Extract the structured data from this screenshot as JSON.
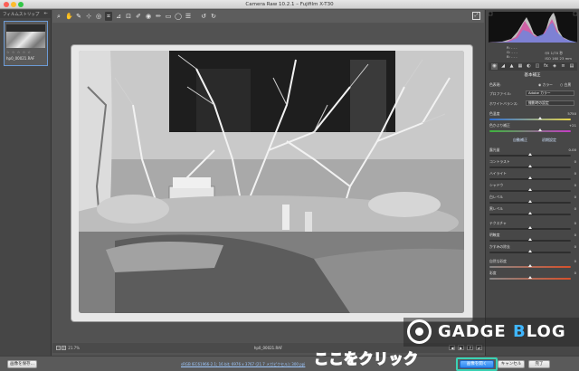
{
  "window": {
    "title": "Camera Raw 10.2.1  –  Fujifilm X-T30"
  },
  "toolbar": {
    "tools": [
      {
        "icon": "zoom-icon",
        "glyph": "⌕"
      },
      {
        "icon": "hand-icon",
        "glyph": "✋"
      },
      {
        "icon": "white-balance-icon",
        "glyph": "✎"
      },
      {
        "icon": "color-sampler-icon",
        "glyph": "⊹"
      },
      {
        "icon": "target-adjustment-icon",
        "glyph": "◎"
      },
      {
        "icon": "crop-icon",
        "glyph": "⌗"
      },
      {
        "icon": "straighten-icon",
        "glyph": "⊿"
      },
      {
        "icon": "transform-icon",
        "glyph": "⊡"
      },
      {
        "icon": "spot-removal-icon",
        "glyph": "✐"
      },
      {
        "icon": "red-eye-icon",
        "glyph": "◉"
      },
      {
        "icon": "adjustment-brush-icon",
        "glyph": "✏"
      },
      {
        "icon": "graduated-filter-icon",
        "glyph": "▭"
      },
      {
        "icon": "radial-filter-icon",
        "glyph": "◯"
      },
      {
        "icon": "preferences-icon",
        "glyph": "☰"
      },
      {
        "icon": "rotate-left-icon",
        "glyph": "↺"
      },
      {
        "icon": "rotate-right-icon",
        "glyph": "↻"
      }
    ],
    "active_tool": 5
  },
  "filmstrip": {
    "header": "フィルムストリップ",
    "collapse_glyph": "⇤",
    "thumb_stars": "☆ ☆ ☆ ☆ ☆",
    "thumb_filename": "hp0_00021.RAF"
  },
  "preview": {
    "zoom": "21.7%",
    "current_file": "hp0_00021.RAF",
    "nav_prev": "◀",
    "nav_next": "▶"
  },
  "footer": {
    "save_button": "画像を保存...",
    "workflow_link": "sRGB IEC61966-2.1; 16 bit; 6976 x 3767 (21.7 メガピクセル); 300 ppi",
    "open_button": "画像を開く",
    "cancel_button": "キャンセル",
    "done_button": "完了",
    "callout": "ここをクリック",
    "highlight_color": "#39d2b4"
  },
  "watermark": {
    "prefix": "GADGE ",
    "highlight": "B",
    "suffix": "LOG"
  },
  "histogram": {
    "r_label": "R:",
    "g_label": "G:",
    "b_label": "B:",
    "r_value": "- - -",
    "g_value": "- - -",
    "b_value": "- - -",
    "exposure_line1": "f/5   1/70 秒",
    "exposure_line2": "ISO 160   23 mm"
  },
  "panel": {
    "title": "基本補正",
    "treatment_label": "色表現:",
    "treatment_color": "カラー",
    "treatment_bw": "白黒",
    "profile_label": "プロファイル:",
    "profile_value": "Adobe カラー",
    "wb_label": "ホワイトバランス:",
    "wb_value": "撮影時の設定",
    "temperature_label": "色温度",
    "temperature_value": "5750",
    "temperature_level": 0.62,
    "tint_label": "色かぶり補正",
    "tint_value": "+21",
    "tint_level": 0.62,
    "auto_label": "自動補正",
    "auto_default": "初期設定",
    "exposure_label": "露光量",
    "exposure_value": "0.00",
    "contrast_label": "コントラスト",
    "contrast_value": "0",
    "highlights_label": "ハイライト",
    "highlights_value": "0",
    "shadows_label": "シャドウ",
    "shadows_value": "0",
    "whites_label": "白レベル",
    "whites_value": "0",
    "blacks_label": "黒レベル",
    "blacks_value": "0",
    "texture_label": "テクスチャ",
    "texture_value": "0",
    "clarity_label": "明瞭度",
    "clarity_value": "0",
    "dehaze_label": "かすみの除去",
    "dehaze_value": "0",
    "vibrance_label": "自然な彩度",
    "vibrance_value": "0",
    "saturation_label": "彩度",
    "saturation_value": "0",
    "tabs": [
      {
        "icon": "basic-tab-icon",
        "glyph": "◉"
      },
      {
        "icon": "tone-curve-tab-icon",
        "glyph": "◢"
      },
      {
        "icon": "detail-tab-icon",
        "glyph": "▲"
      },
      {
        "icon": "hsl-tab-icon",
        "glyph": "▦"
      },
      {
        "icon": "split-toning-tab-icon",
        "glyph": "◐"
      },
      {
        "icon": "lens-tab-icon",
        "glyph": "◫"
      },
      {
        "icon": "effects-tab-icon",
        "glyph": "fx"
      },
      {
        "icon": "calibration-tab-icon",
        "glyph": "◈"
      },
      {
        "icon": "presets-tab-icon",
        "glyph": "≡"
      },
      {
        "icon": "snapshots-tab-icon",
        "glyph": "▤"
      }
    ]
  }
}
